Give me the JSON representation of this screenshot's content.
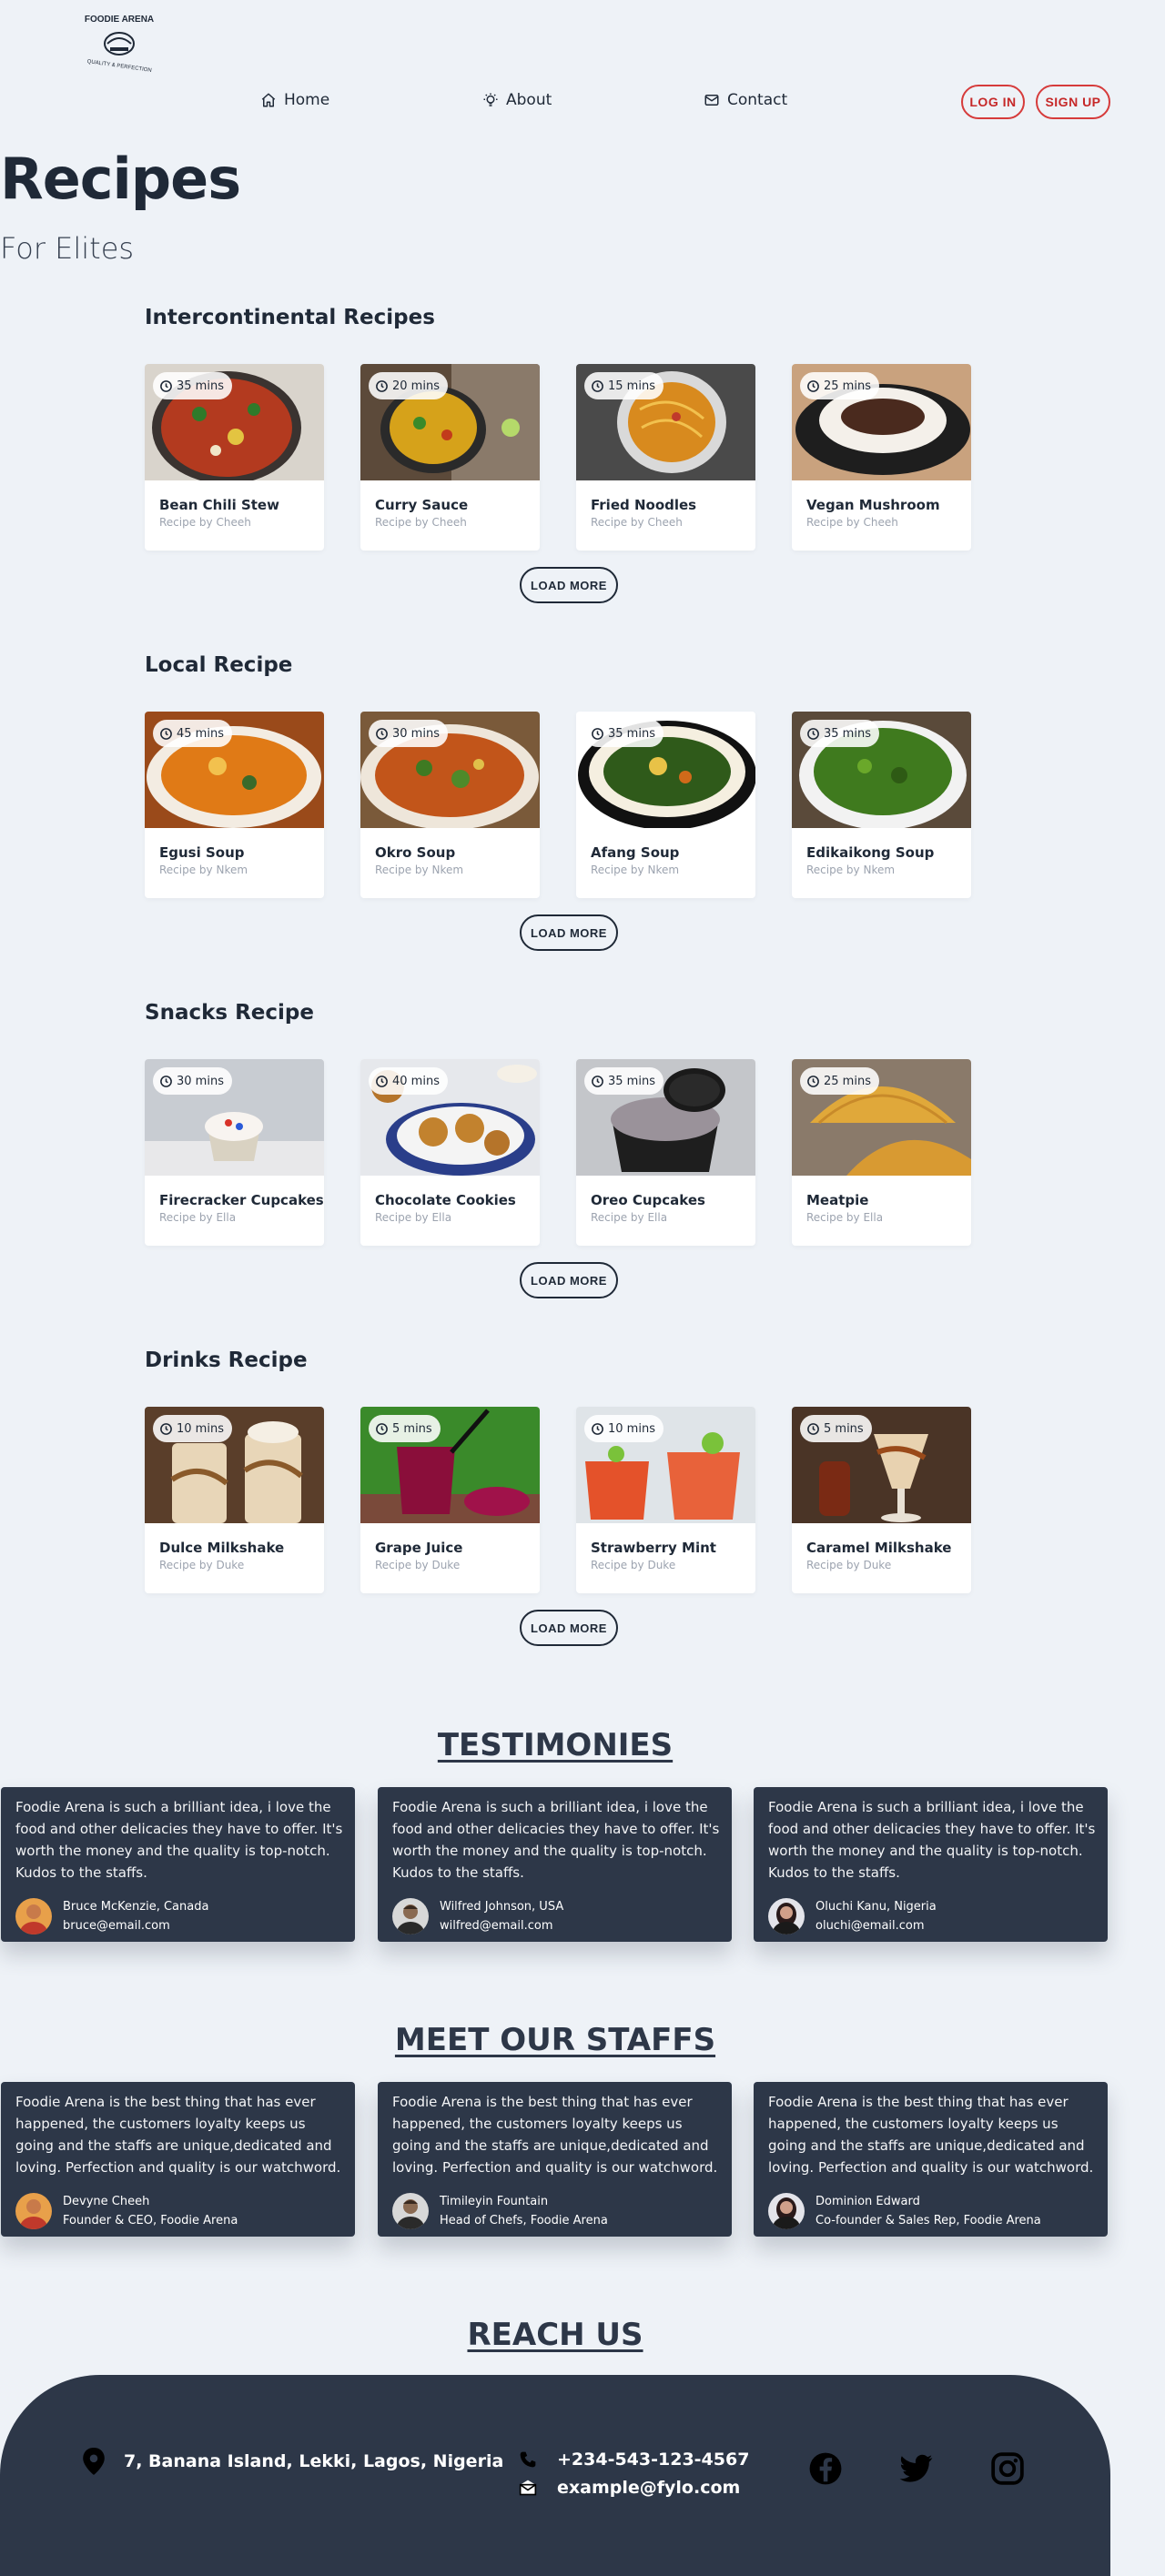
{
  "header": {
    "logo_text_top": "FOODIE ARENA",
    "logo_text_bottom": "QUALITY & PERFECTION",
    "nav": [
      {
        "label": "Home",
        "icon": "home-icon"
      },
      {
        "label": "About",
        "icon": "lightbulb-icon"
      },
      {
        "label": "Contact",
        "icon": "envelope-icon"
      }
    ],
    "login_label": "LOG IN",
    "signup_label": "SIGN UP"
  },
  "hero": {
    "title": "Recipes",
    "subtitle": "For Elites"
  },
  "sections": [
    {
      "title": "Intercontinental Recipes",
      "load_more": "LOAD MORE",
      "cards": [
        {
          "time": "35 mins",
          "name": "Bean Chili Stew",
          "by": "Recipe by Cheeh"
        },
        {
          "time": "20 mins",
          "name": "Curry Sauce",
          "by": "Recipe by Cheeh"
        },
        {
          "time": "15 mins",
          "name": "Fried Noodles",
          "by": "Recipe by Cheeh"
        },
        {
          "time": "25 mins",
          "name": "Vegan Mushroom",
          "by": "Recipe by Cheeh"
        }
      ]
    },
    {
      "title": "Local Recipe",
      "load_more": "LOAD MORE",
      "cards": [
        {
          "time": "45 mins",
          "name": "Egusi Soup",
          "by": "Recipe by Nkem"
        },
        {
          "time": "30 mins",
          "name": "Okro Soup",
          "by": "Recipe by Nkem"
        },
        {
          "time": "35 mins",
          "name": "Afang Soup",
          "by": "Recipe by Nkem"
        },
        {
          "time": "35 mins",
          "name": "Edikaikong Soup",
          "by": "Recipe by Nkem"
        }
      ]
    },
    {
      "title": "Snacks Recipe",
      "load_more": "LOAD MORE",
      "cards": [
        {
          "time": "30 mins",
          "name": "Firecracker Cupcakes",
          "by": "Recipe by Ella"
        },
        {
          "time": "40 mins",
          "name": "Chocolate Cookies",
          "by": "Recipe by Ella"
        },
        {
          "time": "35 mins",
          "name": "Oreo Cupcakes",
          "by": "Recipe by Ella"
        },
        {
          "time": "25 mins",
          "name": "Meatpie",
          "by": "Recipe by Ella"
        }
      ]
    },
    {
      "title": "Drinks Recipe",
      "load_more": "LOAD MORE",
      "cards": [
        {
          "time": "10 mins",
          "name": "Dulce Milkshake",
          "by": "Recipe by Duke"
        },
        {
          "time": "5 mins",
          "name": "Grape Juice",
          "by": "Recipe by Duke"
        },
        {
          "time": "10 mins",
          "name": "Strawberry Mint",
          "by": "Recipe by Duke"
        },
        {
          "time": "5 mins",
          "name": "Caramel Milkshake",
          "by": "Recipe by Duke"
        }
      ]
    }
  ],
  "testimonials": {
    "heading": "TESTIMONIES",
    "items": [
      {
        "text": "Foodie Arena is such a brilliant idea, i love the food and other delicacies they have to offer. It's worth the money and the quality is top-notch. Kudos to the staffs.",
        "name": "Bruce McKenzie, Canada",
        "email": "bruce@email.com"
      },
      {
        "text": "Foodie Arena is such a brilliant idea, i love the food and other delicacies they have to offer. It's worth the money and the quality is top-notch. Kudos to the staffs.",
        "name": "Wilfred Johnson, USA",
        "email": "wilfred@email.com"
      },
      {
        "text": "Foodie Arena is such a brilliant idea, i love the food and other delicacies they have to offer. It's worth the money and the quality is top-notch. Kudos to the staffs.",
        "name": "Oluchi Kanu, Nigeria",
        "email": "oluchi@email.com"
      }
    ]
  },
  "staffs": {
    "heading": "MEET OUR STAFFS",
    "items": [
      {
        "text": "Foodie Arena is the best thing that has ever happened, the customers loyalty keeps us going and the staffs are unique,dedicated and loving. Perfection and quality is our watchword.",
        "name": "Devyne Cheeh",
        "role": "Founder & CEO, Foodie Arena"
      },
      {
        "text": "Foodie Arena is the best thing that has ever happened, the customers loyalty keeps us going and the staffs are unique,dedicated and loving. Perfection and quality is our watchword.",
        "name": "Timileyin Fountain",
        "role": "Head of Chefs, Foodie Arena"
      },
      {
        "text": "Foodie Arena is the best thing that has ever happened, the customers loyalty keeps us going and the staffs are unique,dedicated and loving. Perfection and quality is our watchword.",
        "name": "Dominion Edward",
        "role": "Co-founder & Sales Rep, Foodie Arena"
      }
    ]
  },
  "reach": {
    "heading": "REACH US",
    "address": "7, Banana Island, Lekki, Lagos, Nigeria",
    "phone": "+234-543-123-4567",
    "email": "example@fylo.com",
    "social": [
      "facebook-icon",
      "twitter-icon",
      "instagram-icon"
    ]
  },
  "colors": {
    "page_bg": "#eef2f7",
    "dark": "#2d3748",
    "accent_red": "#c62828"
  }
}
